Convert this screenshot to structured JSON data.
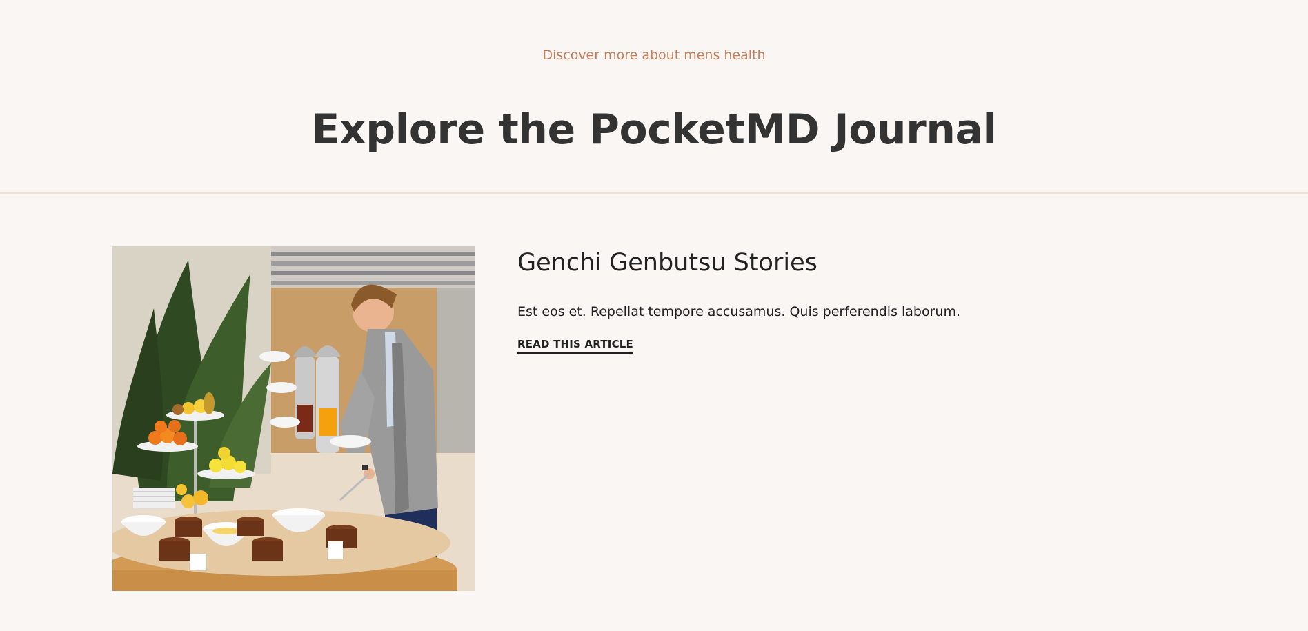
{
  "header": {
    "eyebrow": "Discover more about mens health",
    "title": "Explore the PocketMD Journal"
  },
  "article": {
    "image_alt": "Man serving himself from a breakfast buffet",
    "title": "Genchi Genbutsu Stories",
    "excerpt": "Est eos et. Repellat tempore accusamus. Quis perferendis laborum.",
    "link_label": "READ THIS ARTICLE"
  },
  "colors": {
    "background": "#faf6f3",
    "accent": "#c47d5a",
    "heading": "#333333",
    "divider": "#eee2d6",
    "text": "#222222"
  }
}
